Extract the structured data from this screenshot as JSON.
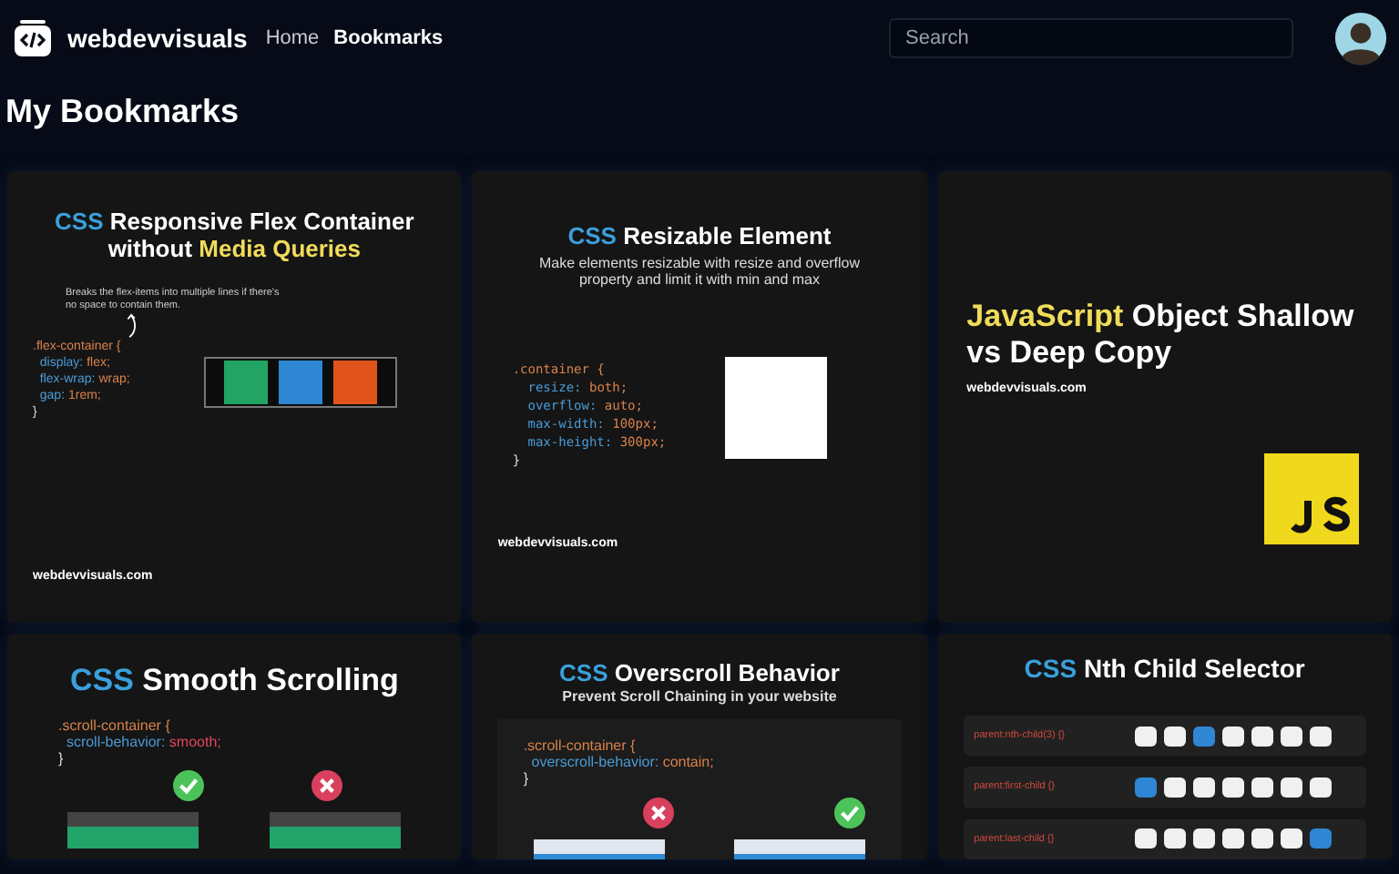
{
  "header": {
    "brand": "webdevvisuals",
    "nav": [
      {
        "label": "Home",
        "selected": false
      },
      {
        "label": "Bookmarks",
        "selected": true
      }
    ],
    "search": {
      "placeholder": "Search"
    }
  },
  "page_title": "My Bookmarks",
  "bookmarks": [
    {
      "kind": "flex",
      "title": [
        {
          "text": "CSS",
          "color": "#3aa0dc"
        },
        {
          "text": " Responsive Flex Container without ",
          "color": "#ffffff"
        },
        {
          "text": "Media Queries",
          "color": "#f0dc5a"
        }
      ],
      "note": "Breaks the flex-items into multiple lines if there's no space to contain them.",
      "code": [
        [
          {
            "text": ".flex-container {",
            "color": "#d9824b"
          }
        ],
        [
          {
            "text": "  display: ",
            "color": "#4a9bd6"
          },
          {
            "text": "flex;",
            "color": "#d9824b"
          }
        ],
        [
          {
            "text": "  flex-wrap: ",
            "color": "#4a9bd6"
          },
          {
            "text": "wrap;",
            "color": "#d9824b"
          }
        ],
        [
          {
            "text": "  gap: ",
            "color": "#4a9bd6"
          },
          {
            "text": "1rem;",
            "color": "#d9824b"
          }
        ],
        [
          {
            "text": "}",
            "color": "#dddddd"
          }
        ]
      ],
      "footer": "webdevvisuals.com"
    },
    {
      "kind": "resizable",
      "title": [
        {
          "text": "CSS",
          "color": "#3aa0dc"
        },
        {
          "text": " Resizable Element",
          "color": "#ffffff"
        }
      ],
      "subtitle": "Make elements resizable with resize and overflow property and limit it with min and max",
      "code": [
        [
          {
            "text": ".container {",
            "color": "#d9824b"
          }
        ],
        [
          {
            "text": "  resize: ",
            "color": "#4a9bd6"
          },
          {
            "text": "both;",
            "color": "#d9824b"
          }
        ],
        [
          {
            "text": "  overflow: ",
            "color": "#4a9bd6"
          },
          {
            "text": "auto;",
            "color": "#d9824b"
          }
        ],
        [
          {
            "text": "  max-width: ",
            "color": "#4a9bd6"
          },
          {
            "text": "100px;",
            "color": "#d9824b"
          }
        ],
        [
          {
            "text": "  max-height: ",
            "color": "#4a9bd6"
          },
          {
            "text": "300px;",
            "color": "#d9824b"
          }
        ],
        [
          {
            "text": "}",
            "color": "#dddddd"
          }
        ]
      ],
      "footer": "webdevvisuals.com"
    },
    {
      "kind": "js",
      "title": [
        {
          "text": "JavaScript",
          "color": "#f0dc5a"
        },
        {
          "text": " Object Shallow vs Deep Copy",
          "color": "#ffffff"
        }
      ],
      "footer": "webdevvisuals.com"
    },
    {
      "kind": "smooth",
      "title": [
        {
          "text": "CSS",
          "color": "#3aa0dc"
        },
        {
          "text": " Smooth Scrolling",
          "color": "#ffffff"
        }
      ],
      "code": [
        [
          {
            "text": ".scroll-container {",
            "color": "#d9824b"
          }
        ],
        [
          {
            "text": "  scroll-behavior: ",
            "color": "#4a9bd6"
          },
          {
            "text": "smooth;",
            "color": "#e0475e"
          }
        ],
        [
          {
            "text": "}",
            "color": "#dddddd"
          }
        ]
      ]
    },
    {
      "kind": "overscroll",
      "title": [
        {
          "text": "CSS",
          "color": "#3aa0dc"
        },
        {
          "text": " Overscroll Behavior",
          "color": "#ffffff"
        }
      ],
      "subtitle": "Prevent Scroll Chaining in your website",
      "code": [
        [
          {
            "text": ".scroll-container {",
            "color": "#d9824b"
          }
        ],
        [
          {
            "text": "  overscroll-behavior: ",
            "color": "#4a9bd6"
          },
          {
            "text": "contain;",
            "color": "#d9824b"
          }
        ],
        [
          {
            "text": "}",
            "color": "#dddddd"
          }
        ]
      ]
    },
    {
      "kind": "nth",
      "title": [
        {
          "text": "CSS",
          "color": "#3aa0dc"
        },
        {
          "text": " Nth Child Selector",
          "color": "#ffffff"
        }
      ],
      "rows": [
        {
          "selector": "parent:nth-child(3) {}",
          "tiles": [
            {
              "selected": false
            },
            {
              "selected": false
            },
            {
              "selected": true
            },
            {
              "selected": false
            },
            {
              "selected": false
            },
            {
              "selected": false
            },
            {
              "selected": false
            }
          ]
        },
        {
          "selector": "parent:first-child {}",
          "tiles": [
            {
              "selected": true
            },
            {
              "selected": false
            },
            {
              "selected": false
            },
            {
              "selected": false
            },
            {
              "selected": false
            },
            {
              "selected": false
            },
            {
              "selected": false
            }
          ]
        },
        {
          "selector": "parent:last-child {}",
          "tiles": [
            {
              "selected": false
            },
            {
              "selected": false
            },
            {
              "selected": false
            },
            {
              "selected": false
            },
            {
              "selected": false
            },
            {
              "selected": false
            },
            {
              "selected": true
            }
          ]
        }
      ]
    }
  ]
}
